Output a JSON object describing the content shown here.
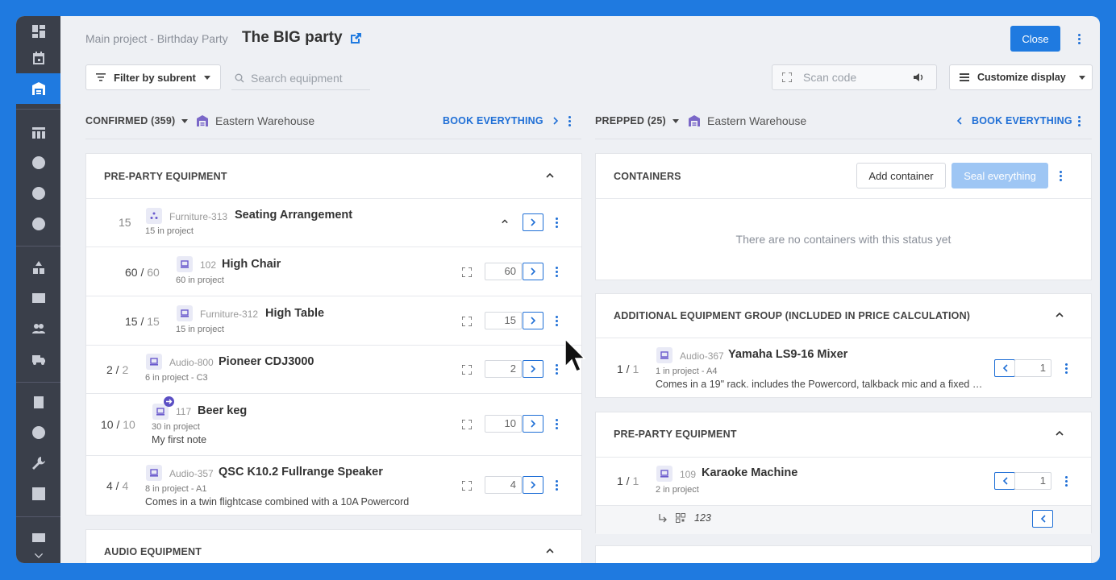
{
  "header": {
    "breadcrumb": "Main project - Birthday Party",
    "title": "The BIG party",
    "close_label": "Close"
  },
  "toolbar": {
    "filter_label": "Filter by subrent",
    "search_placeholder": "Search equipment",
    "scan_placeholder": "Scan code",
    "customize_label": "Customize display"
  },
  "left_column": {
    "status": "CONFIRMED (359)",
    "warehouse": "Eastern Warehouse",
    "book_label": "BOOK EVERYTHING"
  },
  "right_column": {
    "status": "PREPPED (25)",
    "warehouse": "Eastern Warehouse",
    "book_label": "BOOK EVERYTHING"
  },
  "pre_party_panel": {
    "title": "PRE-PARTY EQUIPMENT",
    "group": {
      "qty": "15",
      "code": "Furniture-313",
      "name": "Seating Arrangement",
      "sub": "15 in project"
    },
    "items": [
      {
        "qty": "60",
        "total": "60",
        "code": "102",
        "name": "High Chair",
        "sub": "60 in project",
        "note": "",
        "value": "60"
      },
      {
        "qty": "15",
        "total": "15",
        "code": "Furniture-312",
        "name": "High Table",
        "sub": "15 in project",
        "note": "",
        "value": "15"
      },
      {
        "qty": "2",
        "total": "2",
        "code": "Audio-800",
        "name": "Pioneer CDJ3000",
        "sub": "6 in project - C3",
        "note": "",
        "value": "2"
      },
      {
        "qty": "10",
        "total": "10",
        "code": "117",
        "name": "Beer keg",
        "sub": "30 in project",
        "note": "My first note",
        "value": "10"
      },
      {
        "qty": "4",
        "total": "4",
        "code": "Audio-357",
        "name": "QSC K10.2 Fullrange Speaker",
        "sub": "8 in project - A1",
        "note": "Comes in a twin flightcase combined with a 10A Powercord",
        "value": "4"
      }
    ]
  },
  "audio_panel": {
    "title": "AUDIO EQUIPMENT"
  },
  "containers_panel": {
    "title": "CONTAINERS",
    "add_label": "Add container",
    "seal_label": "Seal everything",
    "empty_text": "There are no containers with this status yet"
  },
  "additional_panel": {
    "title": "ADDITIONAL EQUIPMENT GROUP (INCLUDED IN PRICE CALCULATION)",
    "item": {
      "qty": "1",
      "total": "1",
      "code": "Audio-367",
      "name": "Yamaha LS9-16 Mixer",
      "sub": "1 in project - A4",
      "note": "Comes in a 19\" rack. includes the Powercord, talkback mic and a fixed 2…",
      "value": "1"
    }
  },
  "right_pre_party_panel": {
    "title": "PRE-PARTY EQUIPMENT",
    "item": {
      "qty": "1",
      "total": "1",
      "code": "109",
      "name": "Karaoke Machine",
      "sub": "2 in project",
      "value": "1"
    },
    "serial": "123"
  },
  "colors": {
    "accent": "#1f7ae0",
    "sidebar": "#3a3f4a",
    "link": "#1f6fd6"
  }
}
